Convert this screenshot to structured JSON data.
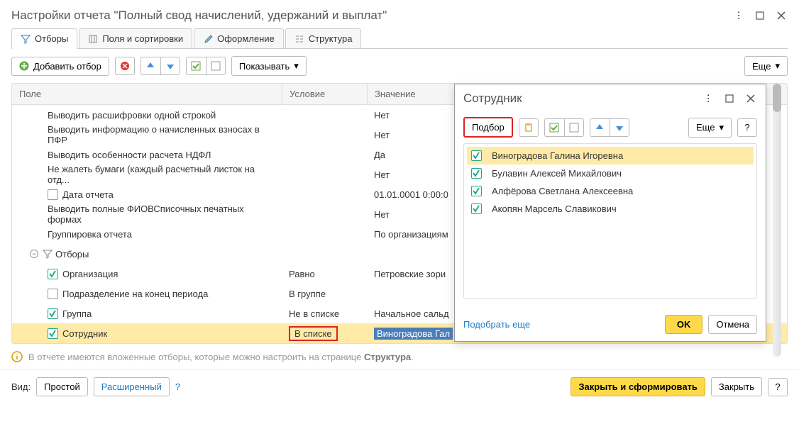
{
  "window_title": "Настройки отчета \"Полный свод начислений, удержаний и выплат\"",
  "tabs": {
    "filters": "Отборы",
    "fields": "Поля и сортировки",
    "format": "Оформление",
    "structure": "Структура"
  },
  "toolbar": {
    "add_filter": "Добавить отбор",
    "show": "Показывать",
    "more": "Еще"
  },
  "table": {
    "headers": {
      "field": "Поле",
      "condition": "Условие",
      "value": "Значение"
    },
    "rows": [
      {
        "field": "Выводить расшифровки одной строкой",
        "value": "Нет"
      },
      {
        "field": "Выводить информацию о начисленных взносах в ПФР",
        "value": "Нет"
      },
      {
        "field": "Выводить особенности расчета НДФЛ",
        "value": "Да"
      },
      {
        "field": "Не жалеть бумаги (каждый расчетный листок на отд...",
        "value": "Нет"
      },
      {
        "field": "Дата отчета",
        "value": "01.01.0001 0:00:0",
        "checkbox": true,
        "checked": false
      },
      {
        "field": "Выводить полные ФИОВСписочных печатных формах",
        "value": "Нет"
      },
      {
        "field": "Группировка отчета",
        "value": "По организациям"
      }
    ],
    "section_label": "Отборы",
    "filter_rows": [
      {
        "field": "Организация",
        "condition": "Равно",
        "value": "Петровские зори",
        "checked": true
      },
      {
        "field": "Подразделение на конец периода",
        "condition": "В группе",
        "value": "",
        "checked": false
      },
      {
        "field": "Группа",
        "condition": "Не в списке",
        "value": "Начальное сальд",
        "checked": true
      },
      {
        "field": "Сотрудник",
        "condition": "В списке",
        "value": "Виноградова Гал",
        "checked": true,
        "highlighted": true
      }
    ]
  },
  "info_text_prefix": "В отчете имеются вложенные отборы, которые можно настроить на странице ",
  "info_text_strong": "Структура",
  "footer": {
    "view_label": "Вид:",
    "simple": "Простой",
    "advanced": "Расширенный",
    "generate": "Закрыть и сформировать",
    "close": "Закрыть"
  },
  "dialog": {
    "title": "Сотрудник",
    "toolbar": {
      "select": "Подбор",
      "more": "Еще"
    },
    "items": [
      "Виноградова Галина Игоревна",
      "Булавин Алексей Михайлович",
      "Алфёрова Светлана Алексеевна",
      "Акопян Марсель Славикович"
    ],
    "more_link": "Подобрать еще",
    "ok": "OK",
    "cancel": "Отмена"
  }
}
